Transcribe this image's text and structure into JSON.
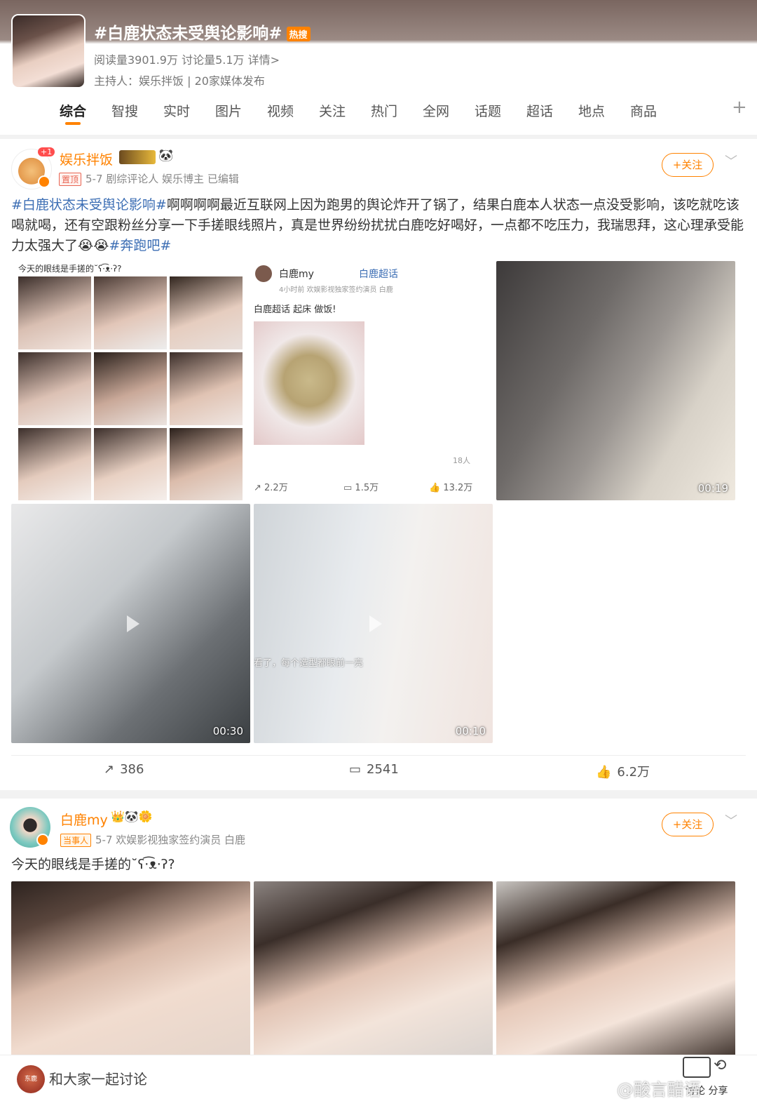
{
  "topic": {
    "title": "#白鹿状态未受舆论影响#",
    "hot_badge": "热搜",
    "stats": "阅读量3901.9万  讨论量5.1万  详情>",
    "host": "主持人：娱乐拌饭 | 20家媒体发布"
  },
  "tabs": [
    "综合",
    "智搜",
    "实时",
    "图片",
    "视频",
    "关注",
    "热门",
    "全网",
    "话题",
    "超话",
    "地点",
    "商品"
  ],
  "tab_plus": "+",
  "post1": {
    "user": "娱乐拌饭",
    "badge_notif": "+1",
    "pin_tag": "置顶",
    "meta": "5-7  剧综评论人 娱乐博主  已编辑",
    "follow": "+关注",
    "chevron": "﹀",
    "text_hash1": "#白鹿状态未受舆论影响#",
    "text_body": "啊啊啊啊最近互联网上因为跑男的舆论炸开了锅了，结果白鹿本人状态一点没受影响，该吃就吃该喝就喝，还有空跟粉丝分享一下手搓眼线照片，真是世界纷纷扰扰白鹿吃好喝好，一点都不吃压力，我瑞思拜，这心理承受能力太强大了😭😭",
    "text_hash2": "#奔跑吧#",
    "collage_caption": "今天的眼线是手搓的˘ʕ·͡ᴥ·ʔ?",
    "embedded": {
      "user": "白鹿my",
      "super_topic": "白鹿超话",
      "meta": "4小时前  欢娱影视独家签约演员 白鹿",
      "text": "白鹿超话  起床 做饭!",
      "likes_count": "18人",
      "repost": "2.2万",
      "comment": "1.5万",
      "like": "13.2万"
    },
    "video1_duration": "00:19",
    "video2_duration": "00:30",
    "video3_duration": "00:10",
    "video3_caption": "看了，每个造型都眼前一亮",
    "repost": "386",
    "comment": "2541",
    "like": "6.2万"
  },
  "post2": {
    "user": "白鹿my",
    "tag": "当事人",
    "meta": "5-7  欢娱影视独家签约演员 白鹿",
    "follow": "+关注",
    "chevron": "﹀",
    "text": "今天的眼线是手搓的˘ʕ·͡ᴥ·ʔ?"
  },
  "bottom": {
    "avatar_text": "东鹿",
    "placeholder": "和大家一起讨论",
    "share_label": "讨论 分享"
  },
  "watermark": "@酸言醋语"
}
